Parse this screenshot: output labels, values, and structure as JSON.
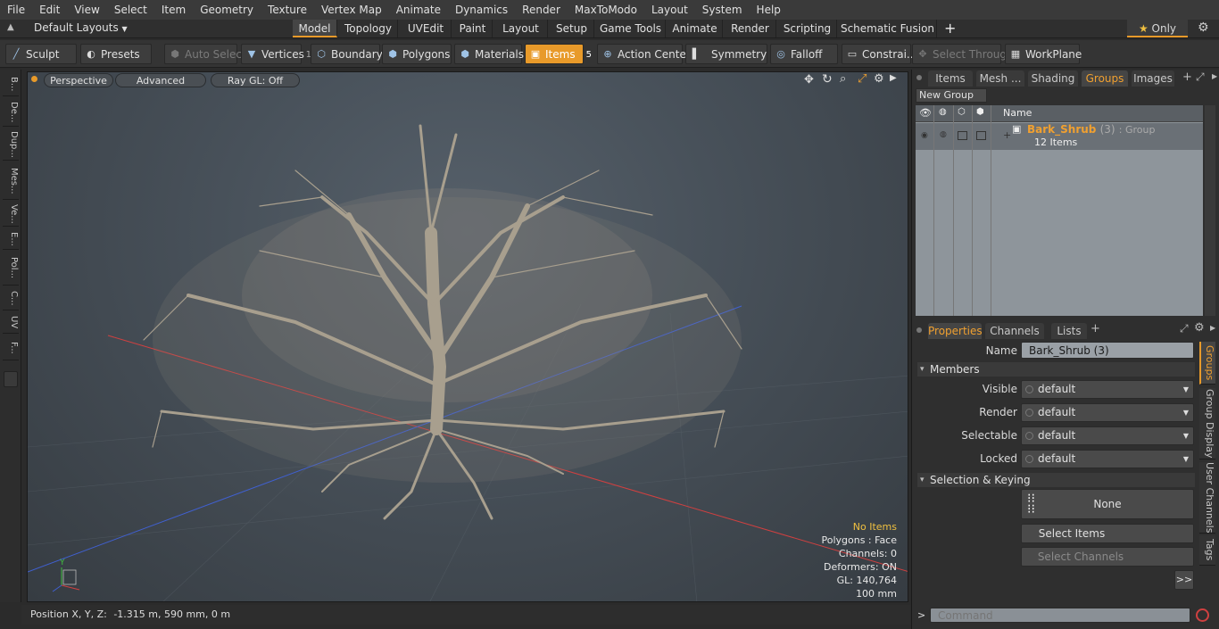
{
  "menu": [
    "File",
    "Edit",
    "View",
    "Select",
    "Item",
    "Geometry",
    "Texture",
    "Vertex Map",
    "Animate",
    "Dynamics",
    "Render",
    "MaxToModo",
    "Layout",
    "System",
    "Help"
  ],
  "layout": {
    "preset": "Default Layouts",
    "tabs": [
      "Model",
      "Topology",
      "UVEdit",
      "Paint",
      "Layout",
      "Setup",
      "Game Tools",
      "Animate",
      "Render",
      "Scripting",
      "Schematic Fusion"
    ],
    "add": "+",
    "only": "Only",
    "star": "★"
  },
  "toolbar": {
    "sculpt": "Sculpt",
    "presets": "Presets",
    "auto_select": "Auto Select",
    "vertices": "Vertices",
    "vertices_count": "1",
    "boundary": "Boundary",
    "polygons": "Polygons",
    "materials": "Materials",
    "items": "Items",
    "items_count": "5",
    "action_center": "Action Center",
    "symmetry": "Symmetry",
    "falloff": "Falloff",
    "constraints": "Constrai...",
    "select_through": "Select Through",
    "workplane": "WorkPlane"
  },
  "leftstrip": [
    "B...",
    "De...",
    "Dup...",
    "Mes...",
    "Ve...",
    "E...",
    "Pol...",
    "C...",
    "UV",
    "F..."
  ],
  "viewport": {
    "perspective": "Perspective",
    "advanced": "Advanced",
    "raygl": "Ray GL: Off",
    "hud": {
      "no_items": "No Items",
      "polygons": "Polygons : Face",
      "channels": "Channels: 0",
      "deformers": "Deformers: ON",
      "gl": "GL: 140,764",
      "scale": "100 mm"
    },
    "axis_y": "Y"
  },
  "status": {
    "label": "Position X, Y, Z:",
    "value": "-1.315 m, 590 mm, 0 m"
  },
  "groups_panel": {
    "tabs": [
      "Items",
      "Mesh ...",
      "Shading",
      "Groups",
      "Images"
    ],
    "active": "Groups",
    "new_group": "New Group",
    "col_name": "Name",
    "group_name": "Bark_Shrub",
    "group_suffix": "(3)",
    "group_type": ": Group",
    "group_count": "12 Items"
  },
  "properties_panel": {
    "tabs": [
      "Properties",
      "Channels",
      "Lists"
    ],
    "name_label": "Name",
    "name_value": "Bark_Shrub (3)",
    "members": "Members",
    "rows": [
      {
        "label": "Visible",
        "value": "default"
      },
      {
        "label": "Render",
        "value": "default"
      },
      {
        "label": "Selectable",
        "value": "default"
      },
      {
        "label": "Locked",
        "value": "default"
      }
    ],
    "selection_keying": "Selection & Keying",
    "none": "None",
    "select_items": "Select Items",
    "select_channels": "Select Channels",
    "more": ">>",
    "side_tabs": [
      "Groups",
      "Group Display",
      "User Channels",
      "Tags"
    ]
  },
  "command": {
    "prompt": ">",
    "placeholder": "Command"
  }
}
